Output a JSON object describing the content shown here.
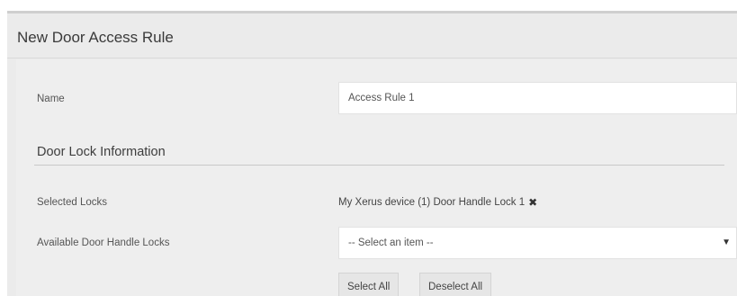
{
  "dialog": {
    "title": "New Door Access Rule"
  },
  "name_field": {
    "label": "Name",
    "value": "Access Rule 1"
  },
  "door_lock_section": {
    "title": "Door Lock Information",
    "selected_locks_label": "Selected Locks",
    "selected_locks": [
      {
        "label": "My Xerus device (1) Door Handle Lock 1",
        "remove_icon": "close-x-icon"
      }
    ],
    "available_label": "Available Door Handle Locks",
    "available_select": {
      "value": "-- Select an item --",
      "icon": "caret-down-icon"
    },
    "select_all_label": "Select All",
    "deselect_all_label": "Deselect All"
  }
}
